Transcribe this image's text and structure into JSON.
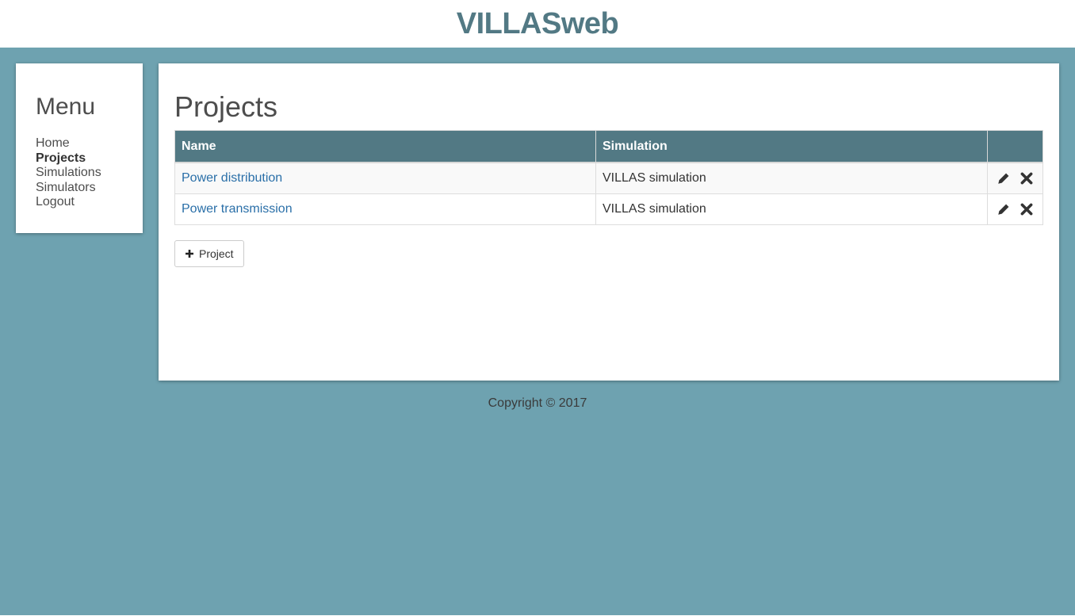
{
  "app": {
    "title": "VILLASweb"
  },
  "colors": {
    "brand": "#527984",
    "backdrop": "#6ea2b0",
    "link": "#2a6fa8"
  },
  "menu": {
    "title": "Menu",
    "items": [
      {
        "label": "Home",
        "active": false
      },
      {
        "label": "Projects",
        "active": true
      },
      {
        "label": "Simulations",
        "active": false
      },
      {
        "label": "Simulators",
        "active": false
      },
      {
        "label": "Logout",
        "active": false
      }
    ]
  },
  "page": {
    "title": "Projects"
  },
  "table": {
    "columns": [
      "Name",
      "Simulation",
      ""
    ],
    "rows": [
      {
        "name": "Power distribution",
        "simulation": "VILLAS simulation",
        "actions": [
          "edit-icon",
          "delete-icon"
        ]
      },
      {
        "name": "Power transmission",
        "simulation": "VILLAS simulation",
        "actions": [
          "edit-icon",
          "delete-icon"
        ]
      }
    ]
  },
  "add_button": {
    "label": "Project",
    "icon": "plus-icon"
  },
  "footer": {
    "text": "Copyright © 2017"
  }
}
